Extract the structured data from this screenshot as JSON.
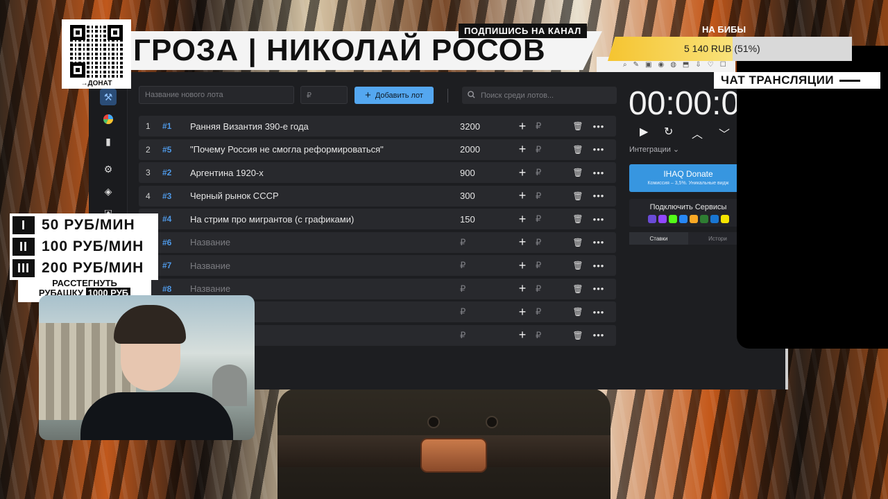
{
  "overlay": {
    "title": "ГРОЗА | НИКОЛАЙ РОСОВ",
    "subscribe": "ПОДПИШИСЬ НА КАНАЛ",
    "goal_label": "НА БИБЫ",
    "goal_text": "5 140 RUB (51%)",
    "goal_percent": 51,
    "qr_label": "→ДОНАТ",
    "chat_label": "ЧАТ ТРАНСЛЯЦИИ",
    "prices": [
      {
        "badge": "I",
        "text": "50 РУБ/МИН"
      },
      {
        "badge": "II",
        "text": "100 РУБ/МИН"
      },
      {
        "badge": "III",
        "text": "200 РУБ/МИН"
      }
    ],
    "shirt_line1": "РАССТЕГНУТЬ",
    "shirt_line2": "РУБАШКУ",
    "shirt_price": "1000 РУБ"
  },
  "app": {
    "new_lot_placeholder": "Название нового лота",
    "amount_placeholder": "₽",
    "add_button": "Добавить лот",
    "search_placeholder": "Поиск среди лотов...",
    "timer": "00:00:0",
    "integrations": "Интеграции ⌄",
    "donate_title": "IHAQ Donate",
    "donate_sub": "Комиссия – 3,5%. Уникальные видж",
    "services_title": "Подключить Сервисы",
    "tab_bets": "Ставки",
    "tab_history": "Истори",
    "currency": "₽",
    "lots": [
      {
        "idx": "1",
        "num": "#1",
        "name": "Ранняя Византия 390-е года",
        "amount": "3200",
        "placeholder": false
      },
      {
        "idx": "2",
        "num": "#5",
        "name": "\"Почему Россия не смогла реформироваться\"",
        "amount": "2000",
        "placeholder": false
      },
      {
        "idx": "3",
        "num": "#2",
        "name": "Аргентина 1920-х",
        "amount": "900",
        "placeholder": false
      },
      {
        "idx": "4",
        "num": "#3",
        "name": "Черный рынок СССР",
        "amount": "300",
        "placeholder": false
      },
      {
        "idx": "5",
        "num": "#4",
        "name": "На стрим про мигрантов (с графиками)",
        "amount": "150",
        "placeholder": false
      },
      {
        "idx": "",
        "num": "#6",
        "name": "Название",
        "amount": "₽",
        "placeholder": true
      },
      {
        "idx": "",
        "num": "#7",
        "name": "Название",
        "amount": "₽",
        "placeholder": true
      },
      {
        "idx": "",
        "num": "#8",
        "name": "Название",
        "amount": "₽",
        "placeholder": true
      },
      {
        "idx": "",
        "num": "",
        "name": "",
        "amount": "₽",
        "placeholder": true
      },
      {
        "idx": "",
        "num": "",
        "name": "",
        "amount": "₽",
        "placeholder": true
      }
    ]
  }
}
